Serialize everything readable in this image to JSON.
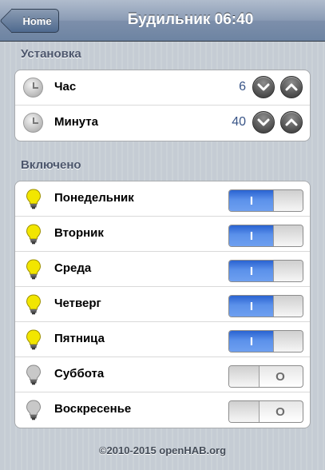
{
  "header": {
    "back_label": "Home",
    "title": "Будильник 06:40"
  },
  "setup": {
    "section_title": "Установка",
    "rows": [
      {
        "label": "Час",
        "value": "6",
        "icon": "clock-icon"
      },
      {
        "label": "Минута",
        "value": "40",
        "icon": "clock-icon"
      }
    ]
  },
  "enabled": {
    "section_title": "Включено",
    "toggle_on_text": "I",
    "toggle_off_text": "O",
    "days": [
      {
        "label": "Понедельник",
        "on": true
      },
      {
        "label": "Вторник",
        "on": true
      },
      {
        "label": "Среда",
        "on": true
      },
      {
        "label": "Четверг",
        "on": true
      },
      {
        "label": "Пятница",
        "on": true
      },
      {
        "label": "Суббота",
        "on": false
      },
      {
        "label": "Воскресенье",
        "on": false
      }
    ]
  },
  "footer": {
    "text": "©2010-2015 openHAB.org"
  },
  "colors": {
    "toolbar": "#6d84a2",
    "toggle_on": "#2a63d2",
    "bulb_on": "#f2e600",
    "bulb_off": "#c8c8c8",
    "value_text": "#385487"
  }
}
